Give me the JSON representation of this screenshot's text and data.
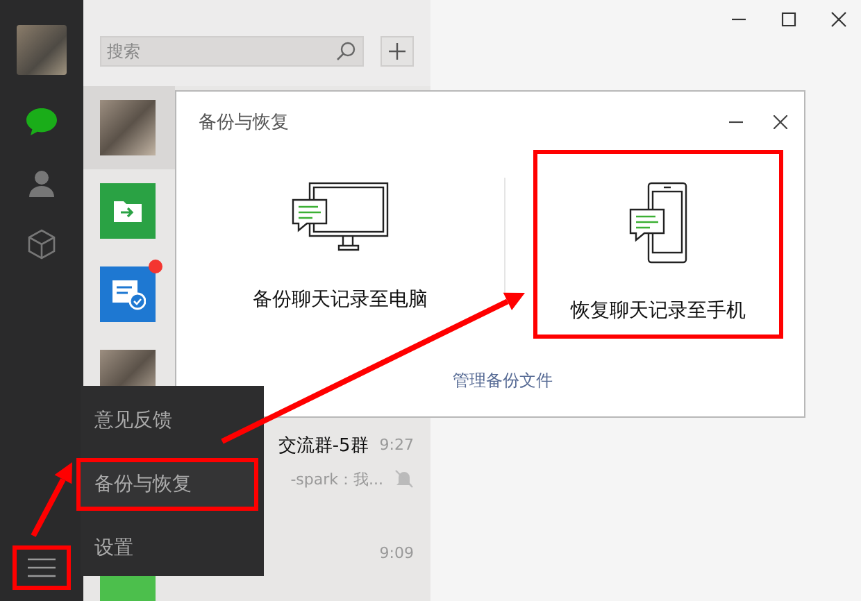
{
  "sidebar": {
    "items": [
      {
        "kind": "chat",
        "selected": true
      },
      {
        "kind": "contacts",
        "selected": false
      },
      {
        "kind": "favorites",
        "selected": false
      }
    ],
    "menu_button": {
      "highlighted": true
    }
  },
  "search": {
    "placeholder": "搜索"
  },
  "chats": [
    {
      "kind": "photo",
      "selected": true
    },
    {
      "kind": "file",
      "selected": false
    },
    {
      "kind": "notice",
      "selected": false,
      "unread": true
    },
    {
      "kind": "photo",
      "selected": false
    },
    {
      "kind": "covered",
      "selected": false,
      "name": "交流群-5群",
      "time": "9:27",
      "preview": "-spark：我...",
      "muted": true
    },
    {
      "kind": "chat",
      "selected": false,
      "time": "9:09"
    }
  ],
  "dialog": {
    "title": "备份与恢复",
    "options": [
      {
        "kind": "computer",
        "label": "备份聊天记录至电脑",
        "highlighted": false
      },
      {
        "kind": "phone",
        "label": "恢复聊天记录至手机",
        "highlighted": true
      }
    ],
    "link": "管理备份文件"
  },
  "menu": {
    "items": [
      {
        "label": "意见反馈",
        "selected": false
      },
      {
        "label": "备份与恢复",
        "selected": true
      },
      {
        "label": "设置",
        "selected": false
      }
    ]
  }
}
